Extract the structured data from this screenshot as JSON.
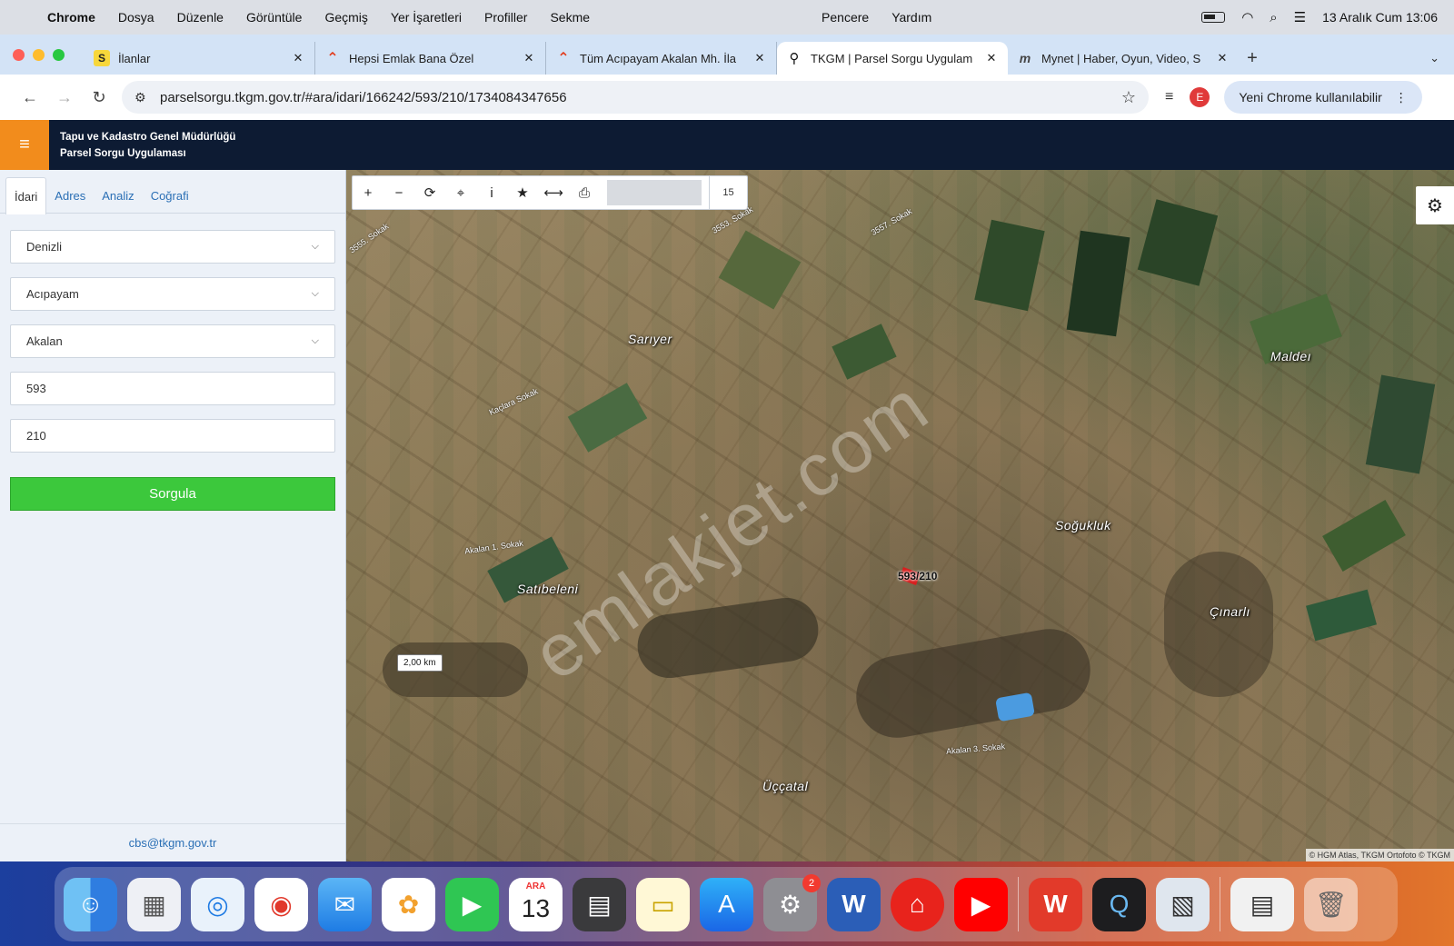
{
  "menubar": {
    "app": "Chrome",
    "items": [
      "Dosya",
      "Düzenle",
      "Görüntüle",
      "Geçmiş",
      "Yer İşaretleri",
      "Profiller",
      "Sekme",
      "Pencere",
      "Yardım"
    ],
    "datetime": "13 Aralık Cum  13:06"
  },
  "tabs": [
    {
      "title": "İlanlar",
      "favicon": "sahibinden-icon"
    },
    {
      "title": "Hepsi Emlak Bana Özel",
      "favicon": "hepsiemlak-icon"
    },
    {
      "title": "Tüm Acıpayam Akalan Mh. İla",
      "favicon": "hepsiemlak-icon"
    },
    {
      "title": "TKGM | Parsel Sorgu Uygulam",
      "favicon": "map-pin-icon"
    },
    {
      "title": "Mynet | Haber, Oyun, Video, S",
      "favicon": "mynet-icon"
    }
  ],
  "address": {
    "url": "parselsorgu.tkgm.gov.tr/#ara/idari/166242/593/210/1734084347656",
    "profile_initial": "E",
    "update_label": "Yeni Chrome kullanılabilir"
  },
  "app": {
    "title_line1": "Tapu ve Kadastro Genel Müdürlüğü",
    "title_line2": "Parsel Sorgu Uygulaması"
  },
  "panel": {
    "tabs": [
      "İdari",
      "Adres",
      "Analiz",
      "Coğrafi"
    ],
    "il": "Denizli",
    "ilce": "Acıpayam",
    "mahalle": "Akalan",
    "ada": "593",
    "parsel": "210",
    "submit": "Sorgula",
    "footer_email": "cbs@tkgm.gov.tr"
  },
  "map": {
    "zoom_level": "15",
    "distance_label": "2,00 km",
    "parcel_label": "593/210",
    "watermark": "emlakjet.com",
    "attribution": "© HGM Atlas, TKGM Ortofoto © TKGM",
    "places": [
      "Sarıyer",
      "Maldeı",
      "Soğukluk",
      "Satıbeleni",
      "Çınarlı",
      "Üççatal"
    ],
    "roads": [
      "3557. Sokak",
      "3553. Sokak",
      "3555. Sokak",
      "Akalan 1. Sokak",
      "Akalan 3. Sokak",
      "Kaçlara Sokak"
    ]
  },
  "dock": {
    "calendar_month": "ARA",
    "calendar_day": "13",
    "settings_badge": "2"
  }
}
